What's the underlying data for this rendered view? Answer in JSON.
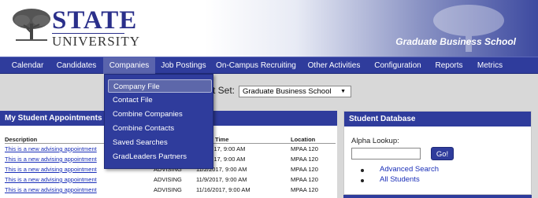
{
  "header": {
    "logo_top": "STATE",
    "logo_bottom": "UNIVERSITY",
    "school_title": "Graduate Business School"
  },
  "nav": {
    "items": [
      {
        "label": "Calendar"
      },
      {
        "label": "Candidates"
      },
      {
        "label": "Companies",
        "active": true
      },
      {
        "label": "Job Postings"
      },
      {
        "label": "On-Campus Recruiting"
      },
      {
        "label": "Other Activities"
      },
      {
        "label": "Configuration"
      },
      {
        "label": "Reports"
      },
      {
        "label": "Metrics"
      }
    ]
  },
  "dropdown": {
    "items": [
      {
        "label": "Company File"
      },
      {
        "label": "Contact File"
      },
      {
        "label": "Combine Companies"
      },
      {
        "label": "Combine Contacts"
      },
      {
        "label": "Saved Searches"
      },
      {
        "label": "GradLeaders Partners"
      }
    ]
  },
  "workset": {
    "label": "t Set:",
    "selected": "Graduate Business School"
  },
  "appointments": {
    "title": "My Student Appointments",
    "headers": {
      "description": "Description",
      "time": "Time",
      "location": "Location"
    },
    "rows": [
      {
        "description": "This is a new advising appointment",
        "type": "",
        "time": "2017, 9:00 AM",
        "location": "MPAA 120"
      },
      {
        "description": "This is a new advising appointment",
        "type": "",
        "time": "2017, 9:00 AM",
        "location": "MPAA 120"
      },
      {
        "description": "This is a new advising appointment",
        "type": "ADVISING",
        "time": "11/2/2017, 9:00 AM",
        "location": "MPAA 120"
      },
      {
        "description": "This is a new advising appointment",
        "type": "ADVISING",
        "time": "11/9/2017, 9:00 AM",
        "location": "MPAA 120"
      },
      {
        "description": "This is a new advising appointment",
        "type": "ADVISING",
        "time": "11/16/2017, 9:00 AM",
        "location": "MPAA 120"
      }
    ]
  },
  "student_db": {
    "title": "Student Database",
    "alpha_label": "Alpha Lookup:",
    "go_label": "Go!",
    "links": [
      {
        "label": "Advanced Search"
      },
      {
        "label": "All Students"
      }
    ]
  },
  "colors": {
    "nav_bg": "#2f3c9c",
    "nav_active": "#5a64ad",
    "link": "#1a2fb8"
  }
}
